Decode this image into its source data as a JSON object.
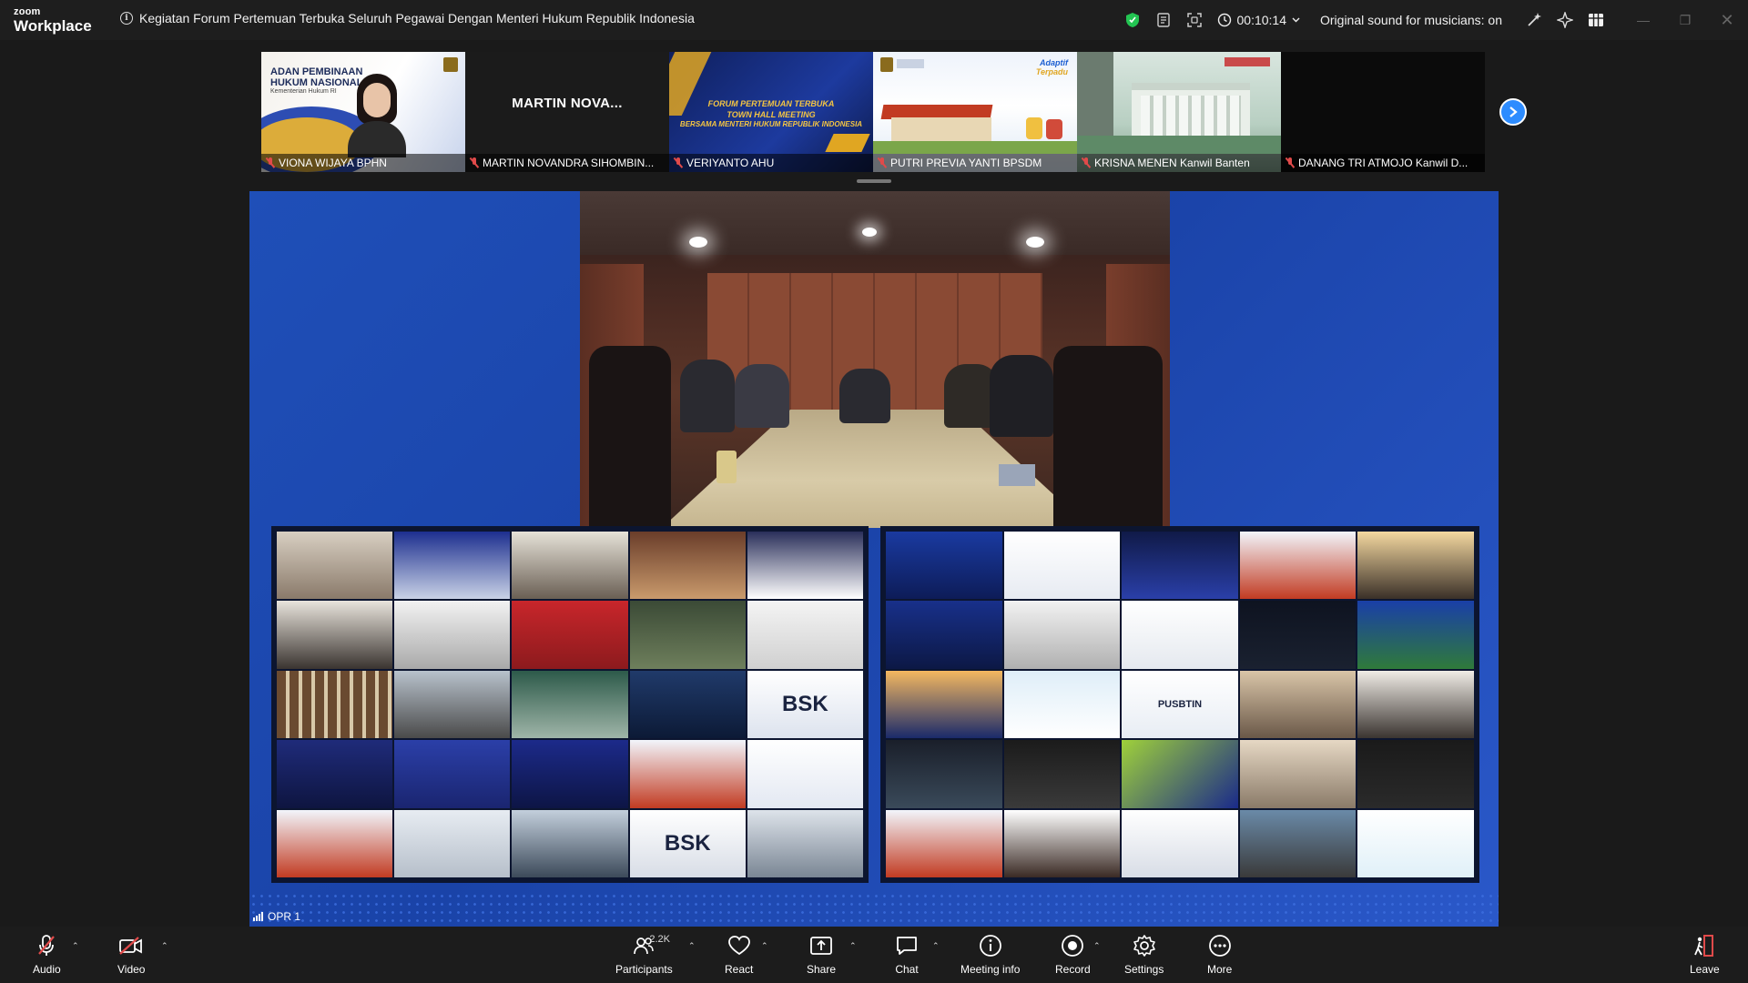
{
  "app": {
    "brand_top": "zoom",
    "brand_bottom": "Workplace"
  },
  "meeting": {
    "title": "Kegiatan Forum Pertemuan Terbuka Seluruh Pegawai Dengan Menteri Hukum Republik Indonesia",
    "elapsed": "00:10:14",
    "original_sound": "Original sound for musicians: on"
  },
  "thumbnails": [
    {
      "name": "VIONA WIJAYA BPHN",
      "slide_line1": "ADAN PEMBINAAN",
      "slide_line2": "HUKUM NASIONAL",
      "slide_line3": "Kementerian Hukum RI"
    },
    {
      "name": "MARTIN NOVANDRA SIHOMBIN...",
      "center_name": "MARTIN NOVA..."
    },
    {
      "name": "VERIYANTO AHU",
      "slide_line1": "FORUM PERTEMUAN TERBUKA",
      "slide_line2": "TOWN HALL MEETING",
      "slide_line3": "BERSAMA MENTERI HUKUM REPUBLIK INDONESIA"
    },
    {
      "name": "PUTRI PREVIA YANTI BPSDM",
      "slide_line1": "Adaptif",
      "slide_line2": "Terpadu"
    },
    {
      "name": "KRISNA MENEN Kanwil Banten"
    },
    {
      "name": "DANANG TRI ATMOJO Kanwil D..."
    }
  ],
  "main_video": {
    "network_label": "OPR 1",
    "tile_text_bsk": "BSK",
    "tile_text_pusbtin": "PUSBTIN"
  },
  "toolbar": {
    "audio": "Audio",
    "video": "Video",
    "participants": "Participants",
    "participants_count": "2.2K",
    "react": "React",
    "share": "Share",
    "chat": "Chat",
    "meeting_info": "Meeting info",
    "record": "Record",
    "settings": "Settings",
    "more": "More",
    "leave": "Leave"
  },
  "colors": {
    "accent": "#2d8cff",
    "muted_red": "#e04a4a",
    "shield_green": "#23c552",
    "stage_blue": "#1f4fb8"
  }
}
